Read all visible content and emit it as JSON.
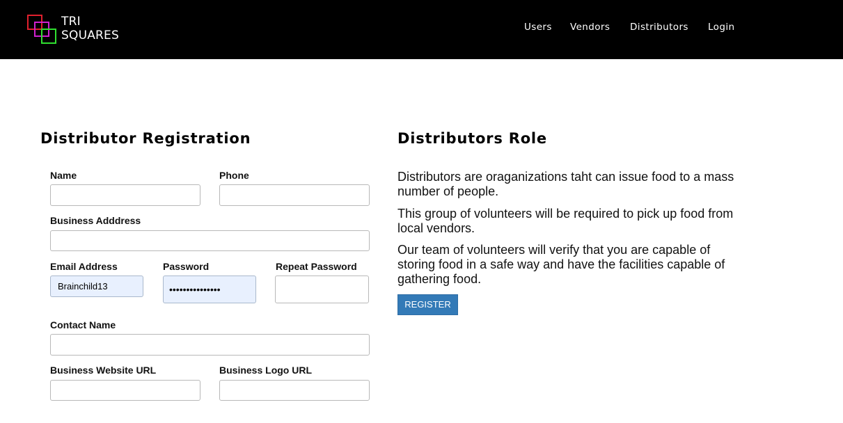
{
  "brand": {
    "line1": "TRI",
    "line2": "SQUARES",
    "colors": [
      "#e0202e",
      "#d020d0",
      "#30e030"
    ]
  },
  "nav": {
    "users": "Users",
    "vendors": "Vendors",
    "distributors": "Distributors",
    "login": "Login"
  },
  "form": {
    "title": "Distributor Registration",
    "name_label": "Name",
    "phone_label": "Phone",
    "address_label": "Business Adddress",
    "email_label": "Email Address",
    "email_value": "Brainchild13",
    "password_label": "Password",
    "password_value": "passwordpasswor",
    "repeat_password_label": "Repeat Password",
    "contact_label": "Contact Name",
    "website_label": "Business Website URL",
    "logo_url_label": "Business Logo URL"
  },
  "role": {
    "title": "Distributors Role",
    "paragraphs": [
      "Distributors are oraganizations taht can issue food to a mass number of people.",
      "This group of volunteers will be required to pick up food from local vendors.",
      "Our team of volunteers will verify that you are capable of storing food in a safe way and have the facilities capable of gathering food."
    ],
    "register_label": "REGISTER",
    "button_color": "#337ab7"
  }
}
